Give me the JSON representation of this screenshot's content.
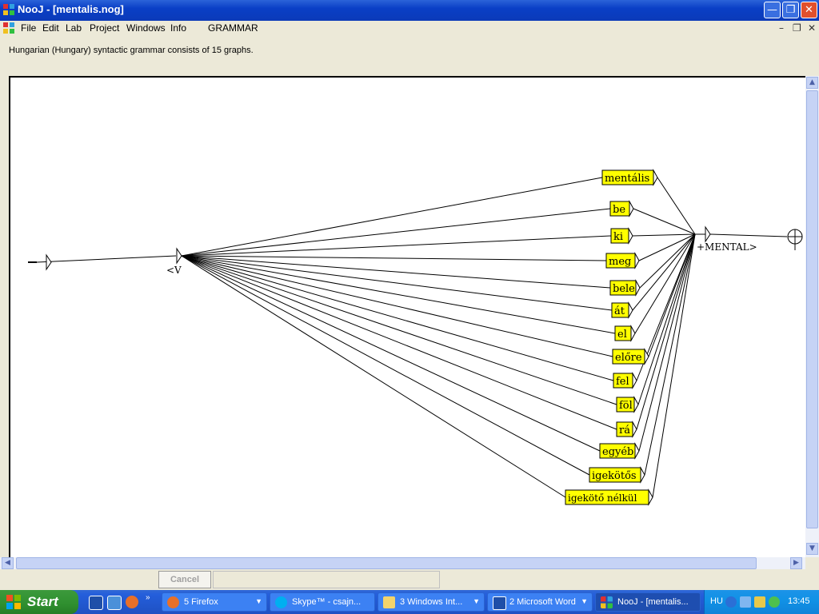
{
  "window": {
    "title": "NooJ - [mentalis.nog]"
  },
  "menu": {
    "items": [
      "File",
      "Edit",
      "Lab",
      "Project",
      "Windows",
      "Info",
      "GRAMMAR"
    ]
  },
  "info": {
    "text": "Hungarian (Hungary) syntactic grammar consists of 15 graphs."
  },
  "graph": {
    "entry_label": "<V",
    "output_label": "+MENTAL>",
    "box_fill": "#ffff00",
    "node_labels": [
      "mentális",
      "be",
      "ki",
      "meg",
      "bele",
      "át",
      "el",
      "előre",
      "fel",
      "föl",
      "rá",
      "egyéb",
      "igekötős",
      "igekötő nélkül"
    ]
  },
  "buttons": {
    "cancel": "Cancel"
  },
  "taskbar": {
    "start": "Start",
    "tasks": [
      "5 Firefox",
      "Skype™ - csajn...",
      "3 Windows Int...",
      "2 Microsoft Word",
      "NooJ - [mentalis..."
    ],
    "lang": "HU",
    "clock": "13:45"
  }
}
